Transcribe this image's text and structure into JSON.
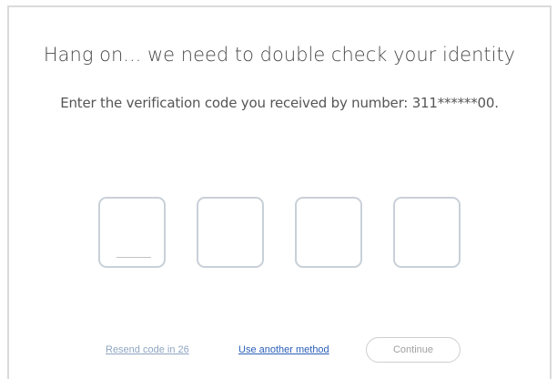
{
  "verification": {
    "title": "Hang on... we need to double check your identity",
    "instruction": "Enter the verification code you received by number: 311******00.",
    "code_digits": [
      "",
      "",
      "",
      ""
    ]
  },
  "footer": {
    "resend_label": "Resend code in 26",
    "another_method_label": "Use another method",
    "continue_label": "Continue"
  },
  "colors": {
    "link_active": "#2b5fb8",
    "link_disabled": "#8fa5c2",
    "box_border": "#c9d0d8"
  }
}
